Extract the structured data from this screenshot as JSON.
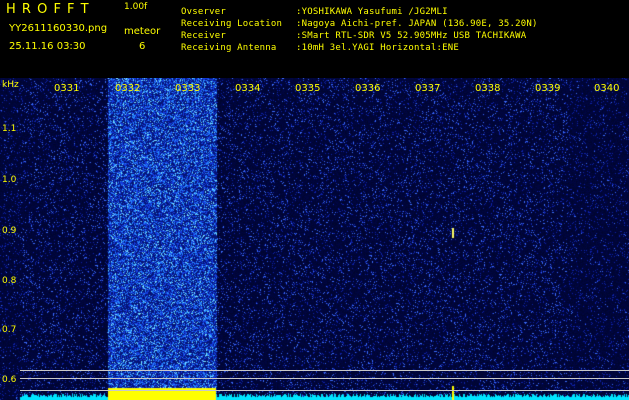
{
  "header": {
    "app_title": "H R O F F T",
    "version": "1.00f",
    "filename": "YY2611160330.png",
    "datetime": "25.11.16 03:30",
    "event_label": "meteor",
    "event_count": "6",
    "info": [
      {
        "key": "Ovserver",
        "value": ":YOSHIKAWA Yasufumi /JG2MLI"
      },
      {
        "key": "Receiving Location",
        "value": ":Nagoya Aichi-pref. JAPAN (136.90E, 35.20N)"
      },
      {
        "key": "Receiver",
        "value": ":SMart RTL-SDR V5 52.905MHz USB TACHIKAWA"
      },
      {
        "key": "Receiving Antenna",
        "value": ":10mH 3el.YAGI Horizontal:ENE"
      }
    ]
  },
  "spectrogram": {
    "unit_label": "kHz",
    "y_ticks": [
      "1.1",
      "1.0",
      "0.9",
      "0.8",
      "0.7",
      "0.6"
    ],
    "time_ticks": [
      "0331",
      "0332",
      "0333",
      "0334",
      "0335",
      "0336",
      "0337",
      "0338",
      "0339",
      "0340"
    ],
    "colors": {
      "background": "#000010",
      "noise": "#1a3cff",
      "burst": "#40a0ff",
      "baseline": "#00e5ff",
      "marker": "#ffff00"
    }
  }
}
